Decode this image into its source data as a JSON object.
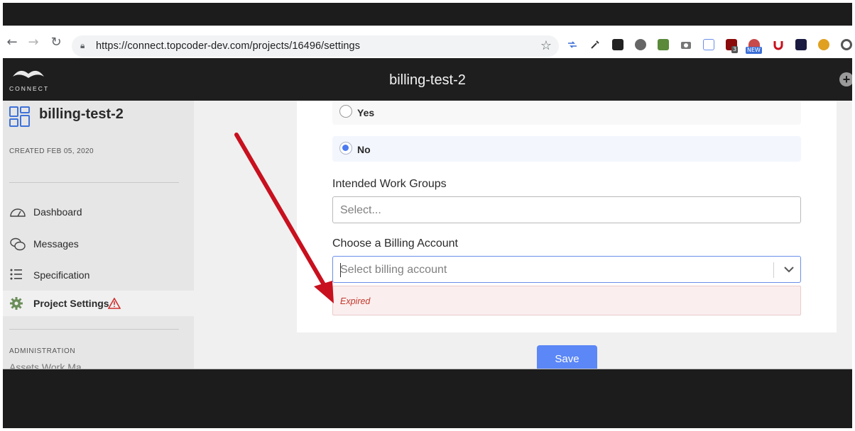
{
  "browser": {
    "url": "https://connect.topcoder-dev.com/projects/16496/settings",
    "extension_badges": {
      "ublock_count": "3",
      "new_badge": "NEW"
    },
    "icons": [
      "back-icon",
      "forward-icon",
      "reload-icon",
      "lock-icon",
      "star-icon"
    ]
  },
  "header": {
    "logo_text": "CONNECT",
    "title": "billing-test-2",
    "add_icon": "plus-circle-icon"
  },
  "sidebar": {
    "project_name": "billing-test-2",
    "created": "CREATED FEB 05, 2020",
    "items": [
      {
        "label": "Dashboard",
        "icon": "dashboard-gauge-icon"
      },
      {
        "label": "Messages",
        "icon": "chat-bubbles-icon"
      },
      {
        "label": "Specification",
        "icon": "list-icon"
      },
      {
        "label": "Project Settings",
        "icon": "gear-icon",
        "warning_icon": "warning-triangle-icon",
        "active": true
      }
    ],
    "admin_label": "ADMINISTRATION",
    "cut_item": "Assets Work Ma..."
  },
  "form": {
    "radio_options": [
      {
        "label": "Yes",
        "checked": false
      },
      {
        "label": "No",
        "checked": true
      }
    ],
    "work_groups": {
      "label": "Intended Work Groups",
      "placeholder": "Select..."
    },
    "billing": {
      "label": "Choose a Billing Account",
      "placeholder": "Select billing account"
    },
    "error": "Expired",
    "save_label": "Save"
  },
  "colors": {
    "accent": "#5b87f7",
    "error_text": "#c0392b",
    "error_bg": "#fbeeee",
    "annotation_arrow": "#c8101e"
  }
}
